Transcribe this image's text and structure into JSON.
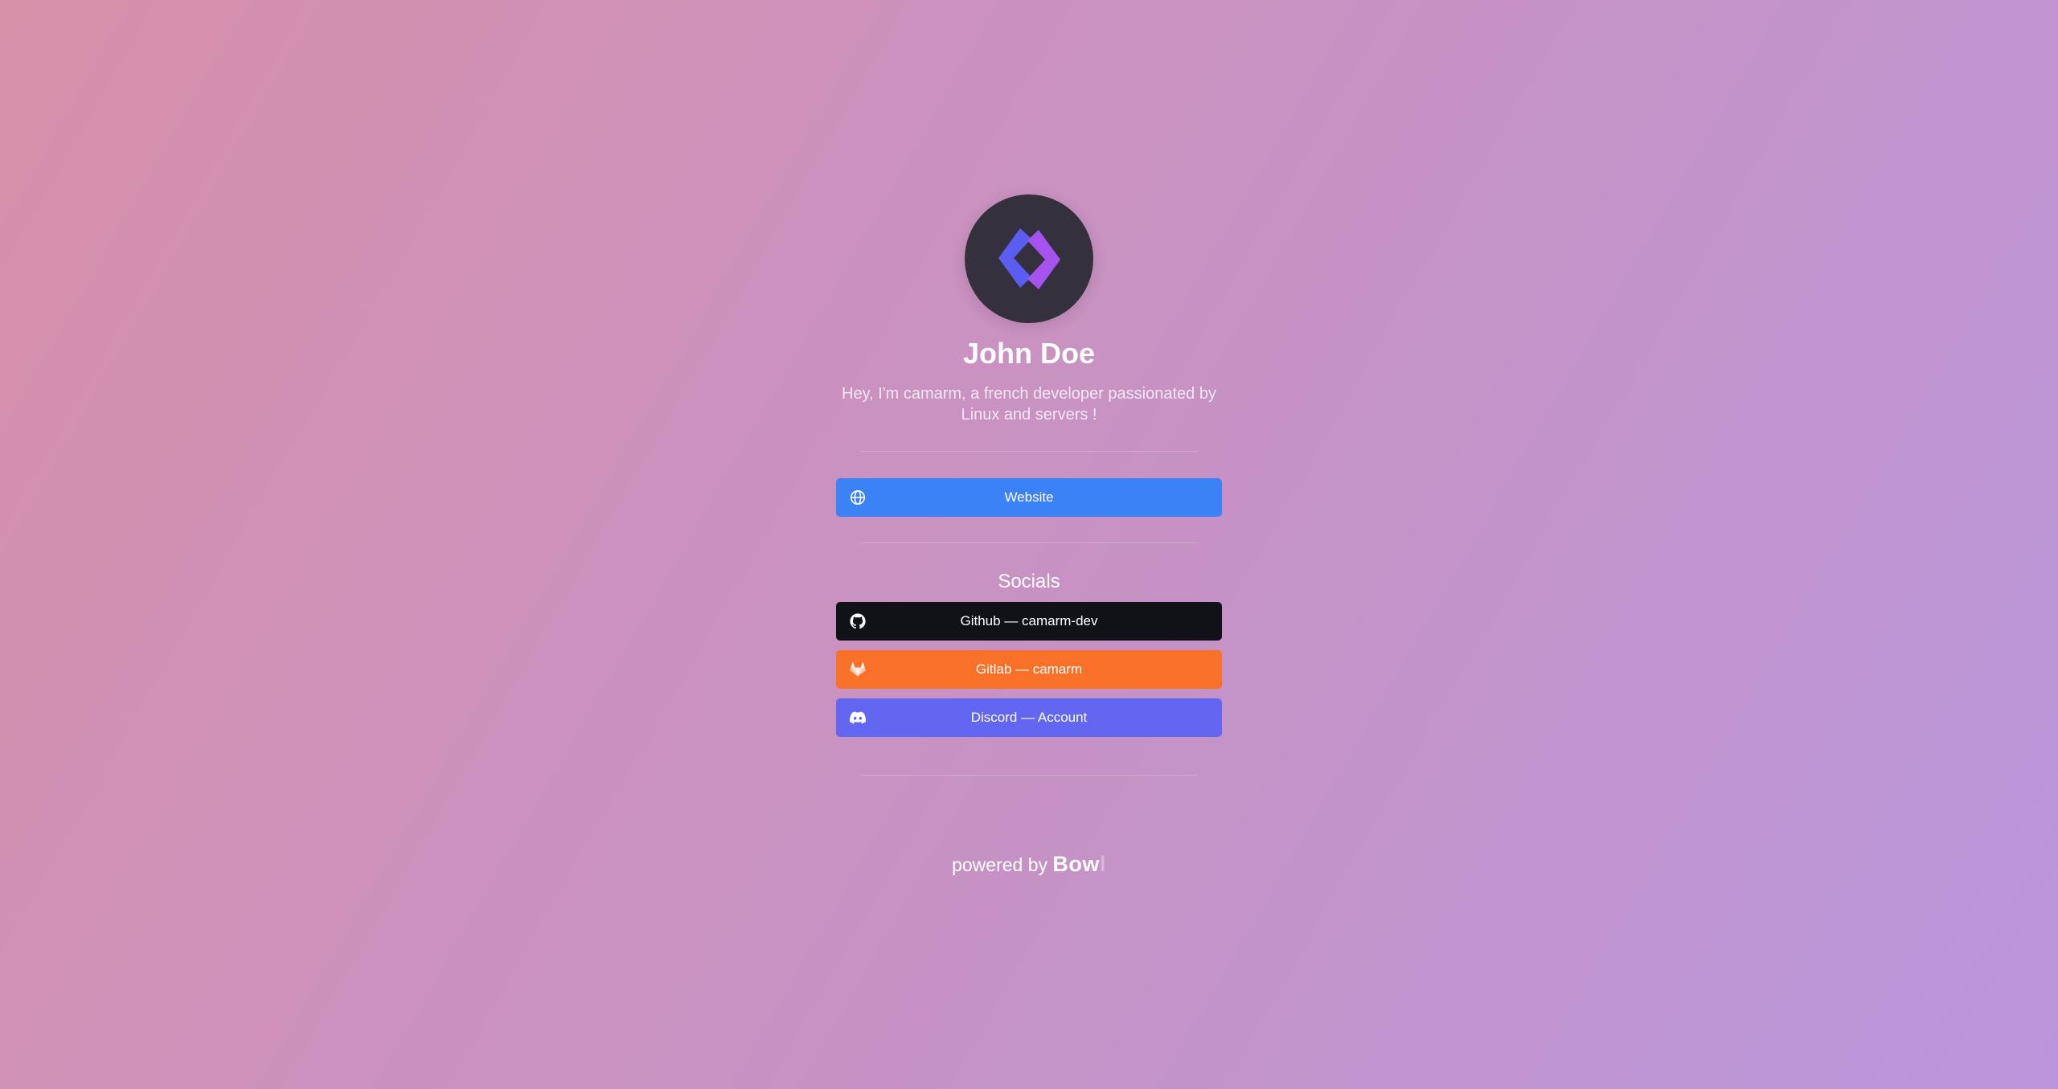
{
  "profile": {
    "name": "John Doe",
    "bio": "Hey, I'm camarm, a french developer passionated by Linux and servers !"
  },
  "links": {
    "website": {
      "label": "Website",
      "color": "#3b82f6",
      "icon": "globe-icon"
    }
  },
  "socials": {
    "title": "Socials",
    "items": [
      {
        "label": "Github — camarm-dev",
        "color": "#111218",
        "icon": "github-icon"
      },
      {
        "label": "Gitlab — camarm",
        "color": "#f97029",
        "icon": "gitlab-icon"
      },
      {
        "label": "Discord — Account",
        "color": "#6366f1",
        "icon": "discord-icon"
      }
    ]
  },
  "footer": {
    "powered_by": "powered by",
    "brand": "Bow",
    "brand_ghost": "l"
  },
  "colors": {
    "avatar_bg": "#35303d",
    "logo_left": "#6366f1",
    "logo_right": "#a855f7"
  }
}
